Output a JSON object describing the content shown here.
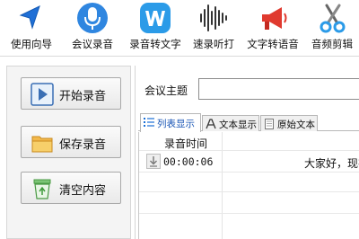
{
  "toolbar": {
    "items": [
      {
        "label": "使用向导",
        "icon": "navigation-arrow-icon"
      },
      {
        "label": "会议录音",
        "icon": "microphone-icon"
      },
      {
        "label": "录音转文字",
        "icon": "w-letter-icon"
      },
      {
        "label": "速录听打",
        "icon": "waveform-icon"
      },
      {
        "label": "文字转语音",
        "icon": "megaphone-icon"
      },
      {
        "label": "音频剪辑",
        "icon": "scissors-icon"
      }
    ]
  },
  "left_panel": {
    "start_record_label": "开始录音",
    "save_record_label": "保存录音",
    "clear_content_label": "清空内容"
  },
  "meeting": {
    "topic_label": "会议主题",
    "topic_value": ""
  },
  "tabs": [
    {
      "label": "列表显示",
      "active": true
    },
    {
      "label": "文本显示",
      "active": false
    },
    {
      "label": "原始文本",
      "active": false
    }
  ],
  "list": {
    "header_time": "录音时间",
    "rows": [
      {
        "time": "00:00:06",
        "text": "大家好，现在"
      }
    ]
  },
  "colors": {
    "accent_blue": "#1a6fd6",
    "tab_active_text": "#1a56b5"
  }
}
